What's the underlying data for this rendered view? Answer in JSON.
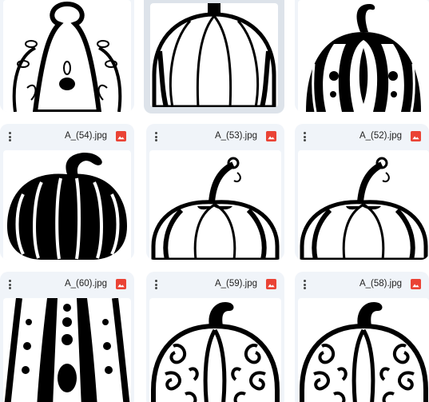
{
  "files": [
    {
      "name": "",
      "type": "image"
    },
    {
      "name": "",
      "type": "image"
    },
    {
      "name": "",
      "type": "image"
    },
    {
      "name": "A_(54).jpg",
      "type": "image"
    },
    {
      "name": "A_(53).jpg",
      "type": "image"
    },
    {
      "name": "A_(52).jpg",
      "type": "image"
    },
    {
      "name": "A_(60).jpg",
      "type": "image"
    },
    {
      "name": "A_(59).jpg",
      "type": "image"
    },
    {
      "name": "A_(58).jpg",
      "type": "image"
    }
  ],
  "icons": {
    "more": "more-vert-icon",
    "file_type": "image-file-icon"
  },
  "colors": {
    "card_bg": "#f0f4f9",
    "selected_card_bg": "#dde3ea",
    "image_icon": "#ea4335"
  }
}
